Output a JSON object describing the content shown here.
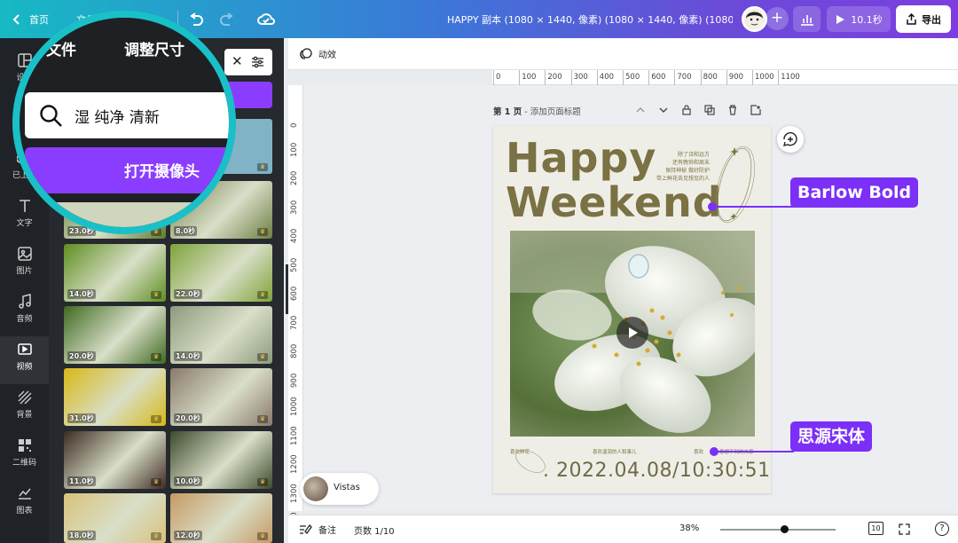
{
  "topbar": {
    "home_label": "首页",
    "file_label": "文件",
    "doc_title": "HAPPY 副本 (1080 × 1440, 像素) (1080 × 1440, 像素) (1080 × 1...",
    "play_label": "10.1秒",
    "export_label": "导出"
  },
  "rail": {
    "items": [
      {
        "label": "设计",
        "icon": "layout-icon"
      },
      {
        "label": "素材",
        "icon": "shapes-icon"
      },
      {
        "label": "已上传",
        "icon": "cloud-upload-icon"
      },
      {
        "label": "文字",
        "icon": "text-icon"
      },
      {
        "label": "图片",
        "icon": "image-icon"
      },
      {
        "label": "音频",
        "icon": "music-icon"
      },
      {
        "label": "视频",
        "icon": "video-icon"
      },
      {
        "label": "背景",
        "icon": "pattern-icon"
      },
      {
        "label": "二维码",
        "icon": "qr-icon"
      },
      {
        "label": "图表",
        "icon": "chart-icon"
      }
    ],
    "active_index": 6
  },
  "magnifier": {
    "tab_file": "文件",
    "tab_resize": "调整尺寸",
    "search_value": "湿 纯净 清新",
    "camera_button": "打开摄像头"
  },
  "videos": [
    {
      "duration": "23.0秒",
      "color": "#5f7a2e"
    },
    {
      "duration": "8.0秒",
      "color": "#6e7f44"
    },
    {
      "duration": "14.0秒",
      "color": "#5e8f1f"
    },
    {
      "duration": "22.0秒",
      "color": "#7fa33a"
    },
    {
      "duration": "20.0秒",
      "color": "#3f6a22"
    },
    {
      "duration": "14.0秒",
      "color": "#8d9a7c"
    },
    {
      "duration": "31.0秒",
      "color": "#d8b816"
    },
    {
      "duration": "20.0秒",
      "color": "#8a7a6c"
    },
    {
      "duration": "11.0秒",
      "color": "#3d2b22"
    },
    {
      "duration": "10.0秒",
      "color": "#3d4a2c"
    },
    {
      "duration": "18.0秒",
      "color": "#d7c27a"
    },
    {
      "duration": "12.0秒",
      "color": "#c69a63"
    }
  ],
  "first_thumb_row": {
    "color_right": "#7fb3c5"
  },
  "workbar": {
    "animate_label": "动效"
  },
  "ruler_h": [
    "0",
    "100",
    "200",
    "300",
    "400",
    "500",
    "600",
    "700",
    "800",
    "900",
    "1000",
    "1100"
  ],
  "ruler_v": [
    "0",
    "100",
    "200",
    "300",
    "400",
    "500",
    "600",
    "700",
    "800",
    "900",
    "1000",
    "1100",
    "1200",
    "1300",
    "1400"
  ],
  "pagebar": {
    "page_label": "第 1 页",
    "page_hint": " - 添加页面标题"
  },
  "design": {
    "title_line1": "Happy",
    "title_line2": "Weekend",
    "poem_lines": [
      "除了诗和远方",
      "还有晚饰和周末",
      "保持神秘 做好防护",
      "带上鲜花去见想见的人"
    ],
    "footer_left": "喜欢鲜花",
    "footer_center": "喜欢温润的人和事儿",
    "footer_right": "喜欢",
    "footer_right_tail": "意想不到的大事",
    "date": ". 2022.04.08/10:30:51"
  },
  "callouts": {
    "font1": "Barlow Bold",
    "font2": "思源宋体"
  },
  "vistas": {
    "label": "Vistas"
  },
  "bottombar": {
    "notes_label": "备注",
    "pages_label": "页数 1/10",
    "zoom": "38%",
    "zoom_fraction": 0.38,
    "page_count_icon": "10"
  },
  "colors": {
    "accent": "#7b2ff7",
    "magnifier_ring": "#19c0c8",
    "title_olive": "#7a7244"
  }
}
